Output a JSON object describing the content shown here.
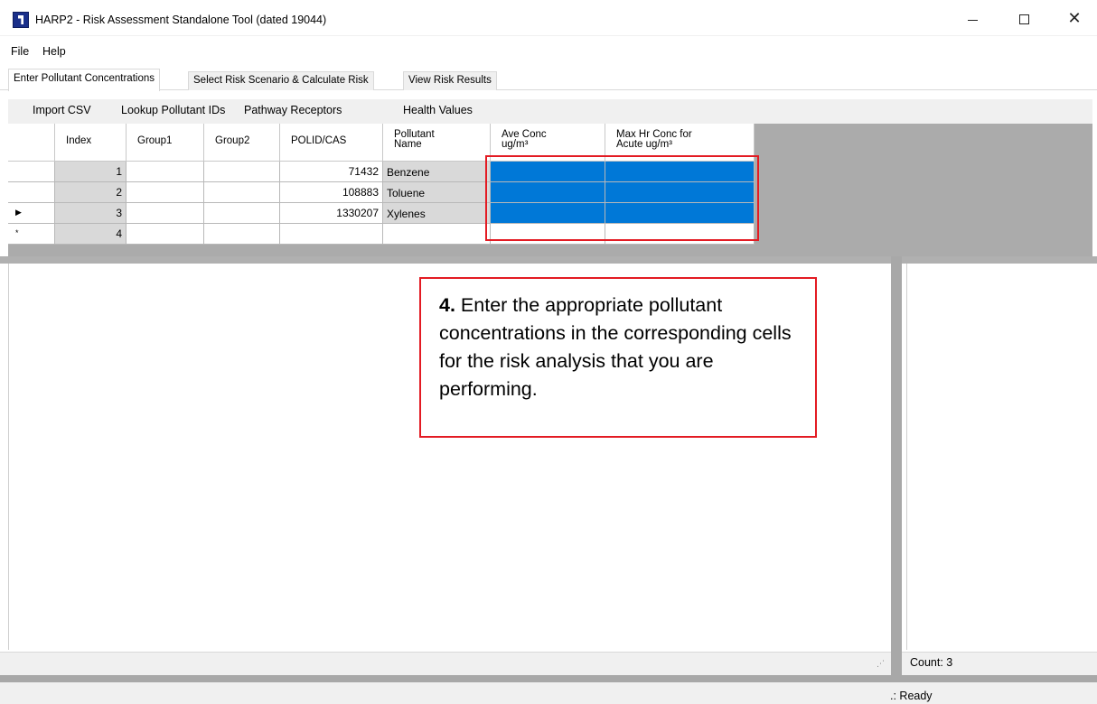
{
  "window": {
    "title": "HARP2 - Risk Assessment Standalone Tool (dated 19044)",
    "controls": {
      "minimize": "minimize-icon",
      "maximize": "maximize-icon",
      "close": "✕"
    }
  },
  "menu": {
    "items": [
      "File",
      "Help"
    ]
  },
  "tabs": [
    {
      "label": "Enter Pollutant Concentrations",
      "active": true
    },
    {
      "label": "Select Risk Scenario & Calculate Risk",
      "active": false
    },
    {
      "label": "View Risk Results",
      "active": false
    }
  ],
  "toolbar": {
    "buttons": [
      "Import CSV",
      "Lookup Pollutant IDs",
      "Pathway Receptors",
      "Health Values"
    ]
  },
  "grid": {
    "columns": [
      {
        "label": "Index"
      },
      {
        "label": "Group1"
      },
      {
        "label": "Group2"
      },
      {
        "label": "POLID/CAS"
      },
      {
        "label": "Pollutant\nName",
        "line1": "Pollutant",
        "line2": "Name"
      },
      {
        "label": "Ave Conc ug/m³",
        "line1": "Ave Conc",
        "line2": "ug/m³"
      },
      {
        "label": "Max Hr Conc for Acute ug/m³",
        "line1": "Max Hr Conc for",
        "line2": "Acute ug/m³"
      }
    ],
    "rows": [
      {
        "marker": "",
        "index": "1",
        "group1": "",
        "group2": "",
        "polid": "71432",
        "name": "Benzene",
        "ave": "",
        "max": ""
      },
      {
        "marker": "",
        "index": "2",
        "group1": "",
        "group2": "",
        "polid": "108883",
        "name": "Toluene",
        "ave": "",
        "max": ""
      },
      {
        "marker": "▶",
        "index": "3",
        "group1": "",
        "group2": "",
        "polid": "1330207",
        "name": "Xylenes",
        "ave": "",
        "max": ""
      },
      {
        "marker": "*",
        "index": "4",
        "group1": "",
        "group2": "",
        "polid": "",
        "name": "",
        "ave": "",
        "max": ""
      }
    ],
    "selection_color": "#0078d7"
  },
  "callout": {
    "number": "4.",
    "text": "Enter the appropriate pollutant concentrations in the corresponding cells for the risk analysis that you are performing.",
    "border_color": "#e31b23"
  },
  "status": {
    "count": "Count: 3",
    "ready": ".: Ready"
  }
}
